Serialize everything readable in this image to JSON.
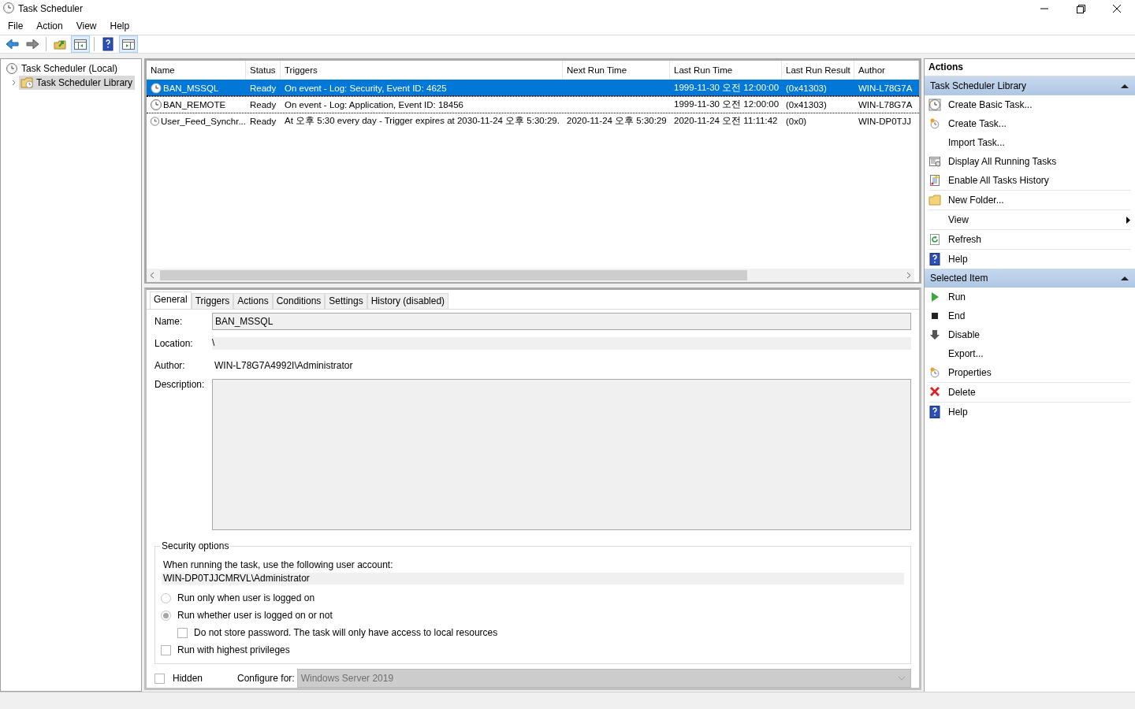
{
  "window": {
    "title": "Task Scheduler"
  },
  "menu": [
    "File",
    "Action",
    "View",
    "Help"
  ],
  "toolbar": [
    {
      "kind": "back"
    },
    {
      "kind": "forward"
    },
    {
      "kind": "folder-up"
    },
    {
      "kind": "pane-left"
    },
    {
      "kind": "help"
    },
    {
      "kind": "pane-right"
    }
  ],
  "tree": [
    {
      "label": "Task Scheduler (Local)",
      "selected": false,
      "expanded": true,
      "children": [
        {
          "label": "Task Scheduler Library",
          "selected": true,
          "expanded": false
        }
      ]
    }
  ],
  "table": {
    "columns": [
      "Name",
      "Status",
      "Triggers",
      "Next Run Time",
      "Last Run Time",
      "Last Run Result",
      "Author"
    ],
    "rows": [
      {
        "selected": true,
        "cells": [
          "BAN_MSSQL",
          "Ready",
          "On event - Log: Security, Event ID: 4625",
          "",
          "1999-11-30 오전 12:00:00",
          "(0x41303)",
          "WIN-L78G7A"
        ]
      },
      {
        "selected": false,
        "cells": [
          "BAN_REMOTE",
          "Ready",
          "On event - Log: Application, Event ID: 18456",
          "",
          "1999-11-30 오전 12:00:00",
          "(0x41303)",
          "WIN-L78G7A"
        ]
      },
      {
        "selected": false,
        "cells": [
          "User_Feed_Synchr...",
          "Ready",
          "At 오후 5:30 every day - Trigger expires at 2030-11-24 오후 5:30:29.",
          "2020-11-24 오후 5:30:29",
          "2020-11-24 오전 11:11:42",
          "(0x0)",
          "WIN-DP0TJJ"
        ]
      }
    ]
  },
  "details": {
    "tabs": [
      {
        "label": "General",
        "selected": true
      },
      {
        "label": "Triggers",
        "selected": false
      },
      {
        "label": "Actions",
        "selected": false
      },
      {
        "label": "Conditions",
        "selected": false
      },
      {
        "label": "Settings",
        "selected": false
      },
      {
        "label": "History (disabled)",
        "selected": false
      }
    ],
    "name_label": "Name:",
    "name": "BAN_MSSQL",
    "location_label": "Location:",
    "location": "\\",
    "author_label": "Author:",
    "author": "WIN-L78G7A4992I\\Administrator",
    "description_label": "Description:",
    "security": {
      "title": "Security options",
      "account_label": "When running the task, use the following user account:",
      "account": "WIN-DP0TJJCMRVL\\Administrator",
      "options": [
        {
          "kind": "radio",
          "label": "Run only when user is logged on",
          "selected": false,
          "indented": false
        },
        {
          "kind": "radio",
          "label": "Run whether user is logged on or not",
          "selected": true,
          "indented": false
        },
        {
          "kind": "checkbox",
          "label": "Do not store password.  The task will only have access to local resources",
          "checked": false,
          "indented": true
        },
        {
          "kind": "checkbox",
          "label": "Run with highest privileges",
          "checked": false,
          "indented": false
        }
      ]
    },
    "hidden": {
      "label": "Hidden",
      "checked": false
    },
    "configure_label": "Configure for:",
    "configure": "Windows Server 2019"
  },
  "actions": {
    "title": "Actions",
    "sections": [
      {
        "title": "Task Scheduler Library",
        "expanded": true,
        "items": [
          {
            "label": "Create Basic Task...",
            "kind": "clock-star",
            "divider": false
          },
          {
            "label": "Create Task...",
            "kind": "clock-small",
            "divider": false
          },
          {
            "label": "Import Task...",
            "kind": "none",
            "divider": false
          },
          {
            "label": "Display All Running Tasks",
            "kind": "list",
            "divider": false
          },
          {
            "label": "Enable All Tasks History",
            "kind": "notes",
            "divider": true
          },
          {
            "label": "New Folder...",
            "kind": "folder",
            "divider": true
          },
          {
            "label": "View",
            "kind": "none",
            "submenu": true,
            "divider": true
          },
          {
            "label": "Refresh",
            "kind": "refresh",
            "divider": true
          },
          {
            "label": "Help",
            "kind": "help",
            "divider": false
          }
        ]
      },
      {
        "title": "Selected Item",
        "expanded": true,
        "items": [
          {
            "label": "Run",
            "kind": "run",
            "divider": false
          },
          {
            "label": "End",
            "kind": "end",
            "divider": false
          },
          {
            "label": "Disable",
            "kind": "down",
            "divider": false
          },
          {
            "label": "Export...",
            "kind": "none",
            "divider": false
          },
          {
            "label": "Properties",
            "kind": "clock-small",
            "divider": true
          },
          {
            "label": "Delete",
            "kind": "delete",
            "divider": true
          },
          {
            "label": "Help",
            "kind": "help",
            "divider": false
          }
        ]
      }
    ]
  }
}
